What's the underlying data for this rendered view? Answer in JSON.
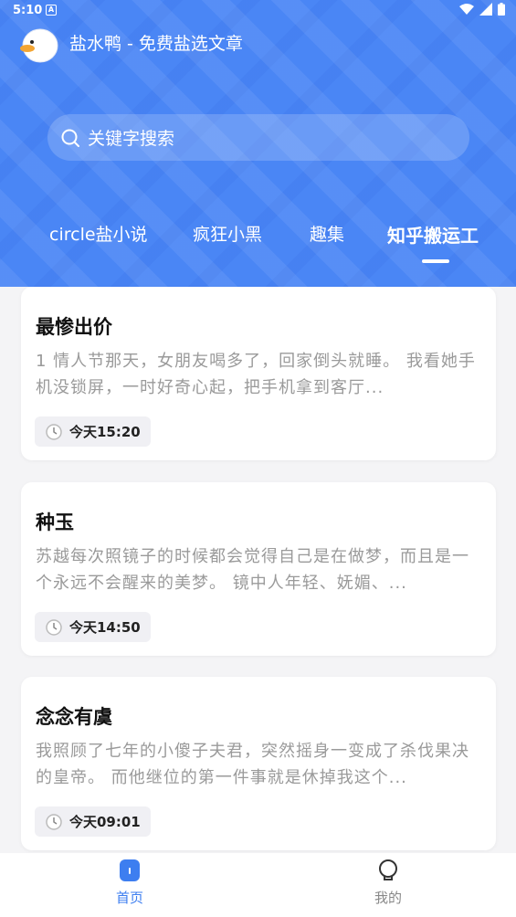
{
  "status_bar": {
    "time": "5:10"
  },
  "header": {
    "title": "盐水鸭 - 免费盐选文章",
    "search_placeholder": "关键字搜索"
  },
  "tabs": [
    {
      "label": "circle盐小说",
      "active": false
    },
    {
      "label": "疯狂小黑",
      "active": false
    },
    {
      "label": "趣集",
      "active": false
    },
    {
      "label": "知乎搬运工",
      "active": true
    }
  ],
  "articles": [
    {
      "title": "最惨出价",
      "excerpt": "1 情人节那天，女朋友喝多了，回家倒头就睡。 我看她手机没锁屏，一时好奇心起，把手机拿到客厅...",
      "time": "今天15:20"
    },
    {
      "title": "种玉",
      "excerpt": "苏越每次照镜子的时候都会觉得自己是在做梦，而且是一个永远不会醒来的美梦。 镜中人年轻、妩媚、...",
      "time": "今天14:50"
    },
    {
      "title": "念念有虞",
      "excerpt": "我照顾了七年的小傻子夫君，突然摇身一变成了杀伐果决的皇帝。 而他继位的第一件事就是休掉我这个...",
      "time": "今天09:01"
    }
  ],
  "bottom_nav": [
    {
      "label": "首页",
      "icon": "home-icon",
      "active": true
    },
    {
      "label": "我的",
      "icon": "lightbulb-icon",
      "active": false
    }
  ],
  "colors": {
    "primary": "#4a86f5",
    "active_nav": "#3d7ef0",
    "inactive_nav": "#888888"
  }
}
